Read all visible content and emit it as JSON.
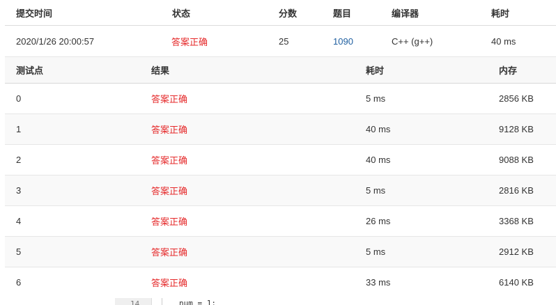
{
  "submission": {
    "headers": {
      "time": "提交时间",
      "status": "状态",
      "score": "分数",
      "problem": "题目",
      "compiler": "编译器",
      "runtime": "耗时"
    },
    "row": {
      "time": "2020/1/26 20:00:57",
      "status": "答案正确",
      "score": "25",
      "problem": "1090",
      "compiler": "C++ (g++)",
      "runtime": "40 ms"
    }
  },
  "test_cases": {
    "headers": {
      "id": "测试点",
      "result": "结果",
      "time": "耗时",
      "memory": "内存"
    },
    "rows": [
      {
        "id": "0",
        "result": "答案正确",
        "time": "5 ms",
        "memory": "2856 KB"
      },
      {
        "id": "1",
        "result": "答案正确",
        "time": "40 ms",
        "memory": "9128 KB"
      },
      {
        "id": "2",
        "result": "答案正确",
        "time": "40 ms",
        "memory": "9088 KB"
      },
      {
        "id": "3",
        "result": "答案正确",
        "time": "5 ms",
        "memory": "2816 KB"
      },
      {
        "id": "4",
        "result": "答案正确",
        "time": "26 ms",
        "memory": "3368 KB"
      },
      {
        "id": "5",
        "result": "答案正确",
        "time": "5 ms",
        "memory": "2912 KB"
      },
      {
        "id": "6",
        "result": "答案正确",
        "time": "33 ms",
        "memory": "6140 KB"
      }
    ]
  },
  "code_preview": {
    "line_number": "14",
    "line_text": "num = 1;"
  },
  "colors": {
    "accepted": "#e5292a",
    "link": "#1f5fa0"
  }
}
